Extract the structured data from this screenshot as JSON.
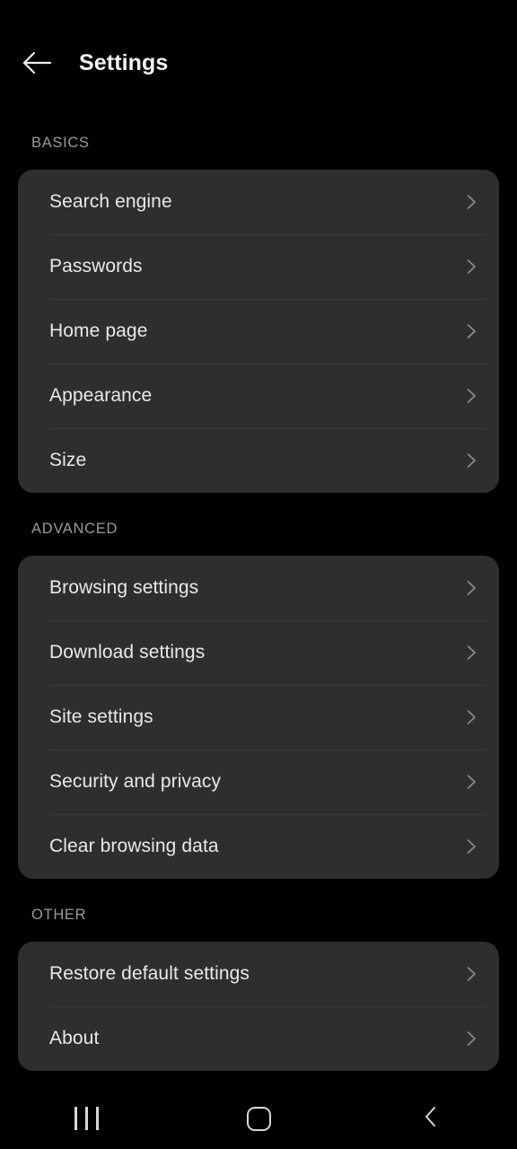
{
  "header": {
    "back_icon": "arrow-left-icon",
    "title": "Settings"
  },
  "sections": [
    {
      "label": "BASICS",
      "items": [
        {
          "label": "Search engine",
          "chevron": "chevron-right-icon"
        },
        {
          "label": "Passwords",
          "chevron": "chevron-right-icon"
        },
        {
          "label": "Home page",
          "chevron": "chevron-right-icon"
        },
        {
          "label": "Appearance",
          "chevron": "chevron-right-icon"
        },
        {
          "label": "Size",
          "chevron": "chevron-right-icon"
        }
      ]
    },
    {
      "label": "ADVANCED",
      "items": [
        {
          "label": "Browsing settings",
          "chevron": "chevron-right-icon"
        },
        {
          "label": "Download settings",
          "chevron": "chevron-right-icon"
        },
        {
          "label": "Site settings",
          "chevron": "chevron-right-icon"
        },
        {
          "label": "Security and privacy",
          "chevron": "chevron-right-icon"
        },
        {
          "label": "Clear browsing data",
          "chevron": "chevron-right-icon"
        }
      ]
    },
    {
      "label": "OTHER",
      "items": [
        {
          "label": "Restore default settings",
          "chevron": "chevron-right-icon"
        },
        {
          "label": "About",
          "chevron": "chevron-right-icon"
        }
      ]
    }
  ],
  "navbar": {
    "recents_label": "recents-icon",
    "home_label": "home-icon",
    "back_label": "back-icon"
  },
  "colors": {
    "background": "#000000",
    "card": "#2e2e2e",
    "divider": "#3b3b3b",
    "primary_text": "#e9e9e9",
    "secondary_text": "#9b9b9b",
    "title_text": "#f2f2f2",
    "chevron": "#8e8e8e"
  }
}
